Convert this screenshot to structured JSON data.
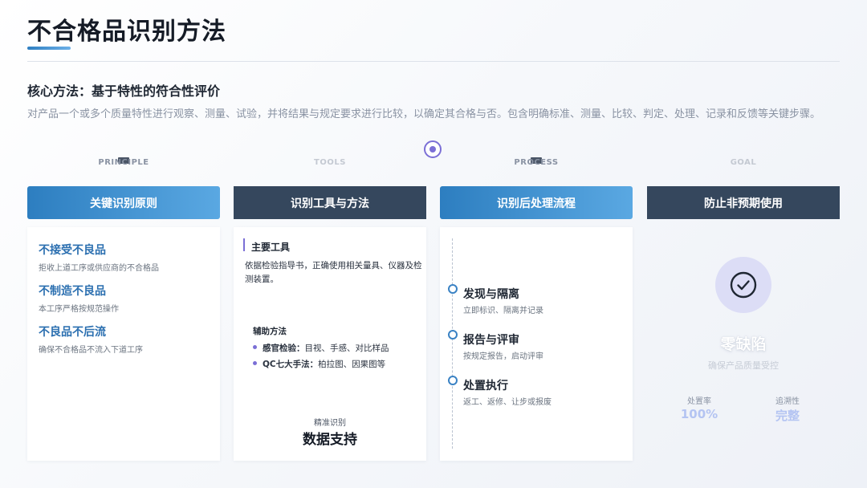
{
  "page": {
    "title": "不合格品识别方法",
    "subtitle": "核心方法：基于特性的符合性评价",
    "description": "对产品一个或多个质量特性进行观察、测量、试验，并将结果与规定要求进行比较，以确定其合格与否。包含明确标准、测量、比较、判定、处理、记录和反馈等关键步骤。"
  },
  "colors": {
    "accent_blue": "#2d7ec0",
    "accent_purple": "#7b6fd6",
    "dark_header": "#35475d"
  },
  "columns": [
    {
      "eyebrow": "PRINCIPLE",
      "header": "关键识别原则"
    },
    {
      "eyebrow": "TOOLS",
      "header": "识别工具与方法"
    },
    {
      "eyebrow": "PROCESS",
      "header": "识别后处理流程"
    },
    {
      "eyebrow": "GOAL",
      "header": "防止非预期使用"
    }
  ],
  "principles": [
    {
      "title": "不接受不良品",
      "desc": "拒收上道工序或供应商的不合格品"
    },
    {
      "title": "不制造不良品",
      "desc": "本工序严格按规范操作"
    },
    {
      "title": "不良品不后流",
      "desc": "确保不合格品不流入下道工序"
    }
  ],
  "tools": {
    "main_title": "主要工具",
    "main_text": "依据检验指导书，正确使用相关量具、仪器及检测装置。",
    "aux_title": "辅助方法",
    "aux_items": [
      {
        "key": "感官检验：",
        "value": "目视、手感、对比样品"
      },
      {
        "key": "QC七大手法：",
        "value": "柏拉图、因果图等"
      }
    ],
    "precision_label": "精准识别",
    "precision_value": "数据支持"
  },
  "process": [
    {
      "title": "发现与隔离",
      "desc": "立即标识、隔离并记录"
    },
    {
      "title": "报告与评审",
      "desc": "按规定报告，启动评审"
    },
    {
      "title": "处置执行",
      "desc": "返工、返修、让步或报废"
    }
  ],
  "goal": {
    "icon": "check-circle-icon",
    "main": "零缺陷",
    "sub": "确保产品质量受控",
    "stats": [
      {
        "label": "处置率",
        "value": "100%"
      },
      {
        "label": "追溯性",
        "value": "完整"
      }
    ]
  }
}
